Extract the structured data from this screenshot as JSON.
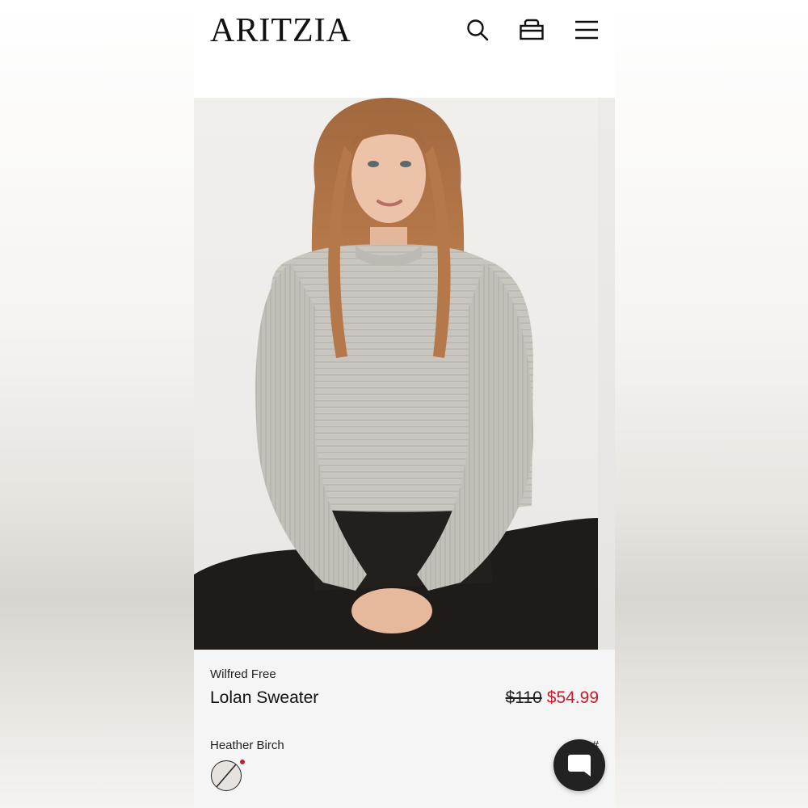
{
  "header": {
    "logo": "ARITZIA",
    "icons": [
      "search-icon",
      "shopping-bag-icon",
      "menu-icon"
    ]
  },
  "hero": {
    "image": "product-photo-model-wearing-sweater"
  },
  "product": {
    "brand": "Wilfred Free",
    "name": "Lolan Sweater",
    "price_original": "$110",
    "price_sale": "$54.99",
    "color_name": "Heather Birch",
    "sku": "#"
  },
  "chat": {
    "icon": "chat-icon"
  },
  "colors": {
    "sale": "#c41e2e",
    "text": "#111111",
    "info_bg": "#f5f5f5",
    "chat_bg": "#222222"
  }
}
